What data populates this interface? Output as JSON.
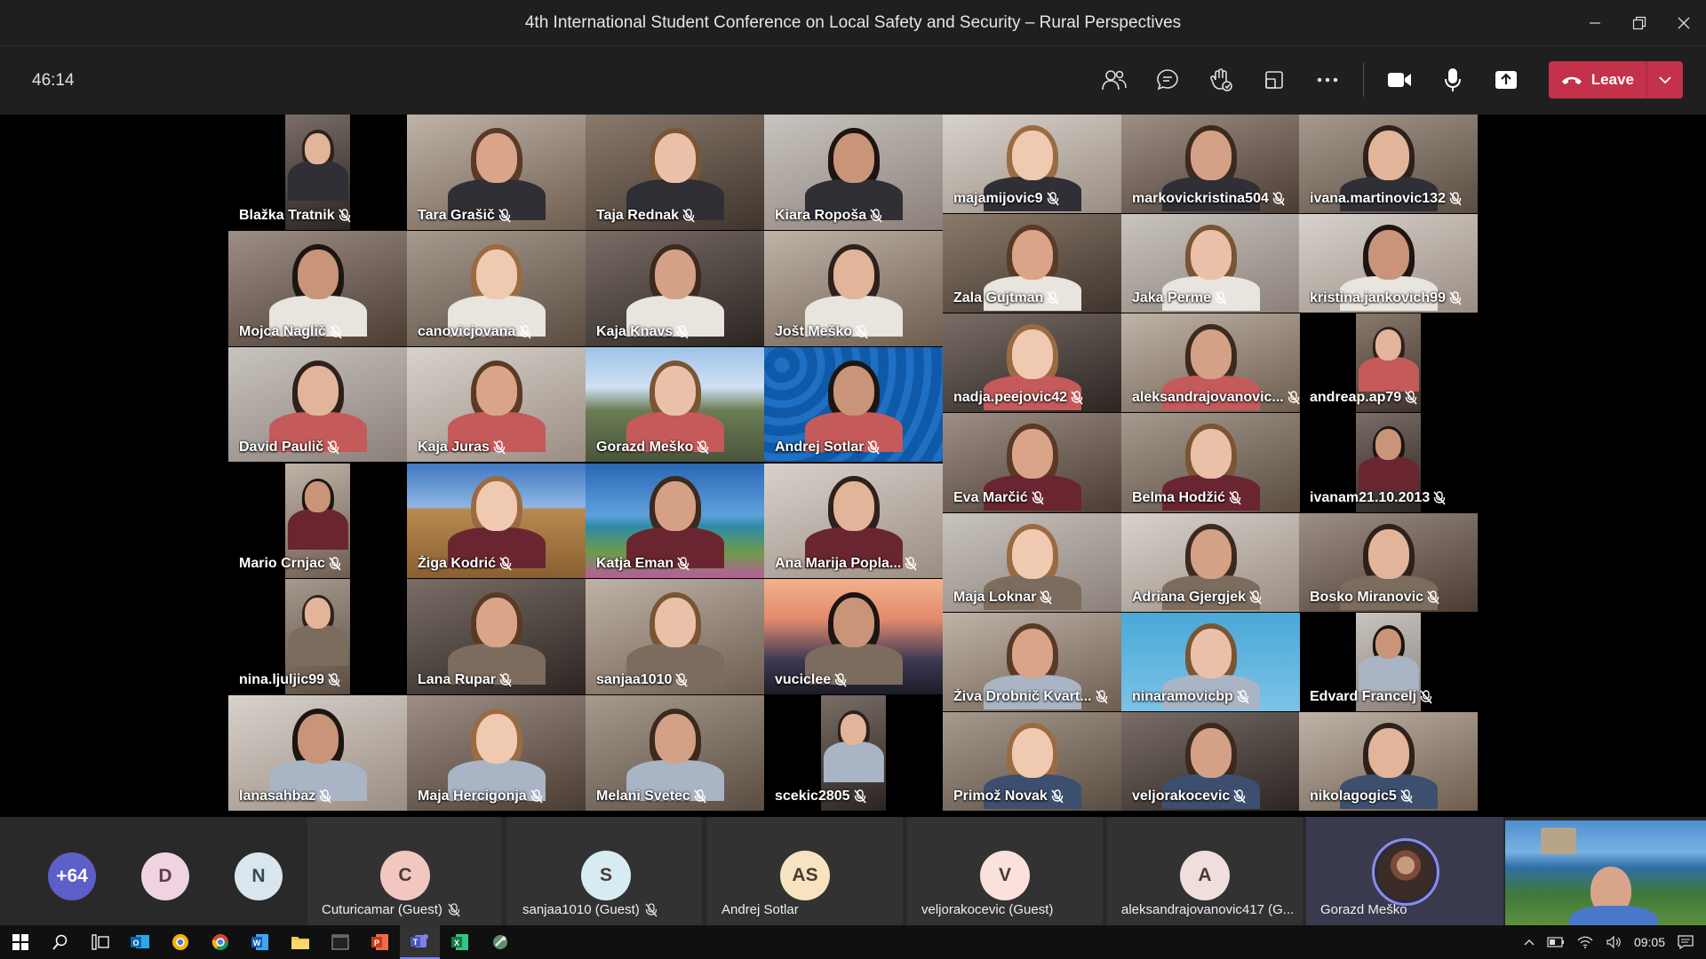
{
  "window": {
    "title": "4th International Student Conference on Local Safety and Security – Rural Perspectives"
  },
  "toolbar": {
    "timer": "46:14",
    "leave_label": "Leave",
    "icons": [
      "participants-icon",
      "chat-icon",
      "reactions-icon",
      "rooms-icon",
      "more-icon",
      "camera-icon",
      "mic-icon",
      "share-icon"
    ]
  },
  "grid": {
    "columns": [
      [
        "Blažka Tratnik",
        "Mojca Naglič",
        "David Paulič",
        "Mario Crnjac",
        "nina.ljuljic99",
        "lanasahbaz"
      ],
      [
        "Tara Grašič",
        "canovicjovana",
        "Kaja Juras",
        "Žiga Kodrić",
        "Lana Rupar",
        "Maja Hercigonja"
      ],
      [
        "Taja Rednak",
        "Kaja Knavs",
        "Gorazd Meško",
        "Katja Eman",
        "sanjaa1010",
        "Melani Svetec"
      ],
      [
        "Kiara Ropoša",
        "Jošt Meško",
        "Andrej Sotlar",
        "Ana   Marija Popla...",
        "vuciclee",
        "scekic2805"
      ],
      [
        "majamijovic9",
        "Zala Gujtman",
        "nadja.peejovic42",
        "Eva Marčić",
        "Maja Loknar",
        "Živa Drobnič Kvart...",
        "Primož Novak"
      ],
      [
        "markovickristina504",
        "Jaka Perme",
        "aleksandrajovanovic...",
        "Belma Hodžić",
        "Adriana Gjergjek",
        "ninaramovicbp",
        "veljorakocevic"
      ],
      [
        "ivana.martinovic132",
        "kristina.jankovich99",
        "andreap.ap79",
        "ivanam21.10.2013",
        "Bosko Miranovic",
        "Edvard Francelj",
        "nikolagogic5"
      ]
    ]
  },
  "strip": {
    "overflow_count": "+64",
    "small_avatars": [
      "D",
      "N"
    ],
    "cards": [
      {
        "initials": "C",
        "name": "Cuturicamar (Guest)",
        "muted": true
      },
      {
        "initials": "S",
        "name": "sanjaa1010 (Guest)",
        "muted": true
      },
      {
        "initials": "AS",
        "name": "Andrej Sotlar",
        "muted": false
      },
      {
        "initials": "V",
        "name": "veljorakocevic (Guest)",
        "muted": false
      },
      {
        "initials": "A",
        "name": "aleksandrajovanovic417 (G...",
        "muted": false
      },
      {
        "initials": "",
        "name": "Gorazd Meško",
        "muted": false
      }
    ]
  },
  "taskbar": {
    "apps": [
      "windows-start-icon",
      "search-icon",
      "task-view-icon",
      "outlook-icon",
      "chrome-canary-icon",
      "chrome-icon",
      "word-icon",
      "file-explorer-icon",
      "terminal-icon",
      "powerpoint-icon",
      "teams-icon",
      "excel-icon",
      "settings-tool-icon"
    ],
    "clock": "09:05"
  }
}
